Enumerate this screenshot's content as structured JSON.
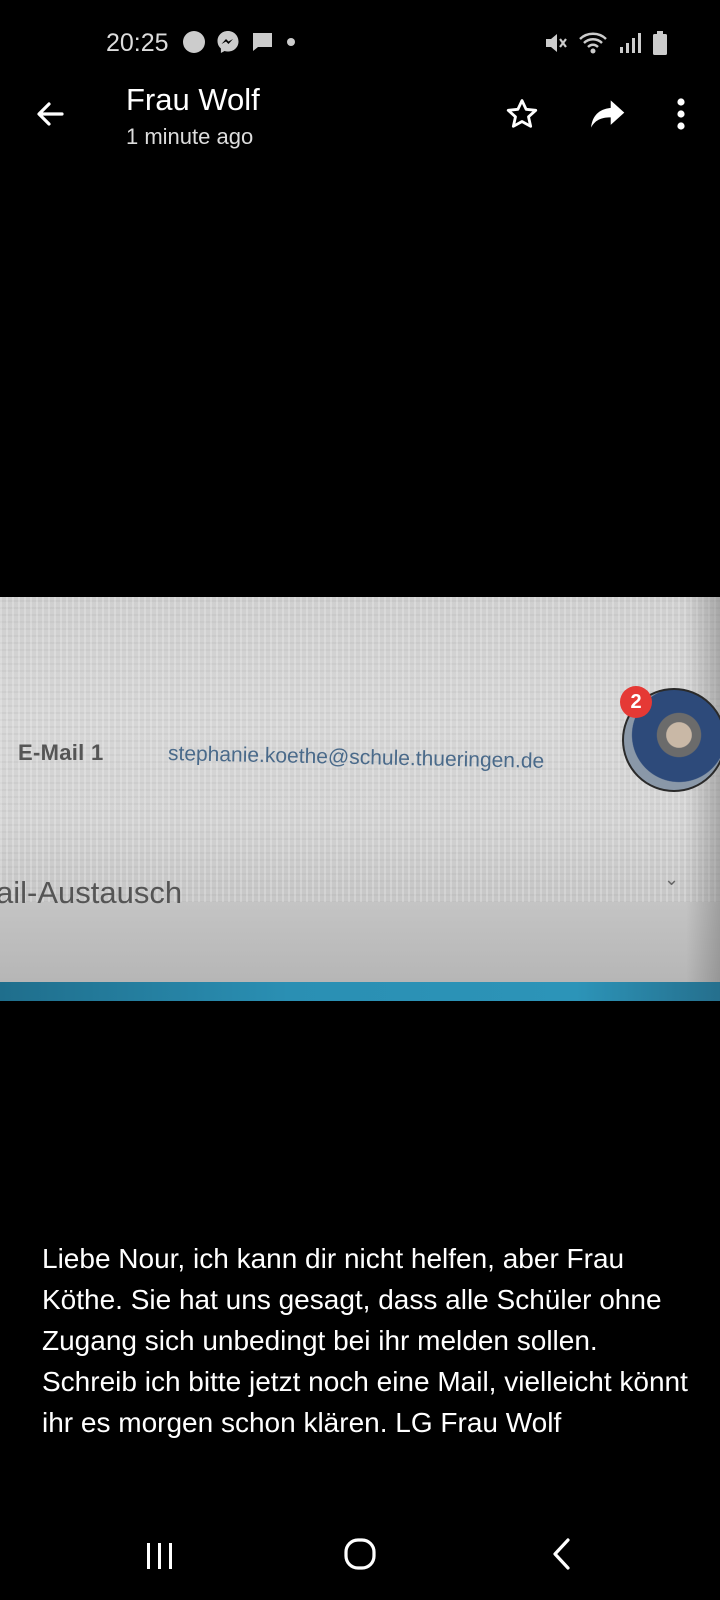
{
  "status_bar": {
    "time": "20:25"
  },
  "header": {
    "title": "Frau Wolf",
    "subtitle": "1 minute ago"
  },
  "photo": {
    "label": "E-Mail 1",
    "email": "stephanie.koethe@schule.thueringen.de",
    "partial_text": "ail-Austausch"
  },
  "chat_head": {
    "badge_count": "2"
  },
  "caption": "Liebe Nour, ich kann dir nicht helfen, aber Frau Köthe. Sie hat uns gesagt, dass alle Schüler ohne Zugang sich unbedingt bei ihr melden sollen. Schreib ich bitte jetzt noch eine Mail, vielleicht könnt ihr es morgen schon klären. LG Frau Wolf",
  "colors": {
    "background": "#000000",
    "badge": "#e53935"
  }
}
